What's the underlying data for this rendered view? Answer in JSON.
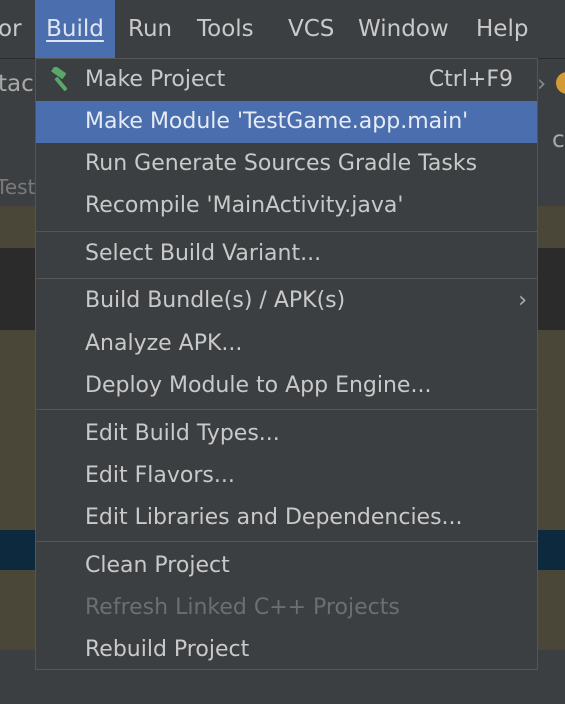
{
  "menubar": {
    "items": [
      {
        "label": "or"
      },
      {
        "label": "Build"
      },
      {
        "label": "Run"
      },
      {
        "label": "Tools"
      },
      {
        "label": "VCS"
      },
      {
        "label": "Window"
      },
      {
        "label": "Help"
      }
    ]
  },
  "background": {
    "toolbar_text": "tac",
    "editor_tab_text": "Test",
    "right_edge_text": "c"
  },
  "build_menu": {
    "items": [
      {
        "label": "Make Project",
        "shortcut": "Ctrl+F9",
        "icon": "hammer-icon"
      },
      {
        "label": "Make Module 'TestGame.app.main'",
        "selected": true
      },
      {
        "label": "Run Generate Sources Gradle Tasks"
      },
      {
        "label": "Recompile 'MainActivity.java'"
      },
      {
        "label": "Select Build Variant..."
      },
      {
        "label": "Build Bundle(s) / APK(s)",
        "submenu": true
      },
      {
        "label": "Analyze APK..."
      },
      {
        "label": "Deploy Module to App Engine..."
      },
      {
        "label": "Edit Build Types..."
      },
      {
        "label": "Edit Flavors..."
      },
      {
        "label": "Edit Libraries and Dependencies..."
      },
      {
        "label": "Clean Project"
      },
      {
        "label": "Refresh Linked C++ Projects",
        "disabled": true
      },
      {
        "label": "Rebuild Project"
      }
    ]
  },
  "colors": {
    "selection": "#4b6eaf",
    "hammer": "#59a869",
    "background": "#3c3f41"
  }
}
